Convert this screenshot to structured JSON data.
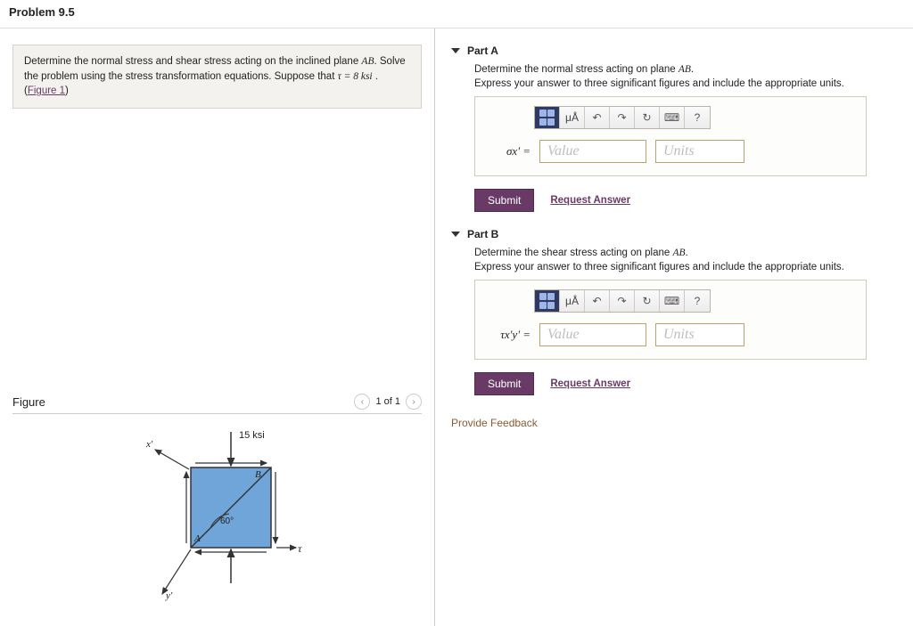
{
  "header": {
    "title": "Problem 9.5"
  },
  "problem": {
    "text_pre": "Determine the normal stress and shear stress acting on the inclined plane ",
    "ab": "AB",
    "text_mid": ". Solve the problem using the stress transformation equations. Suppose that ",
    "tau_eq": "τ = 8 ksi",
    "text_post": " . (",
    "figure_link": "Figure 1",
    "text_close": ")"
  },
  "figure": {
    "label": "Figure",
    "pager": "1 of 1",
    "stress_label": "15 ksi",
    "angle": "60°",
    "pt_a": "A",
    "pt_b": "B",
    "axis_x": "x'",
    "axis_y": "y'",
    "tau": "τ"
  },
  "parts": [
    {
      "title": "Part A",
      "prompt_pre": "Determine the normal stress acting on plane ",
      "prompt_ab": "AB",
      "prompt_post": ".",
      "directions": "Express your answer to three significant figures and include the appropriate units.",
      "symbol": "σx' =",
      "value_ph": "Value",
      "units_ph": "Units",
      "submit": "Submit",
      "request": "Request Answer",
      "mu": "μÅ",
      "help": "?"
    },
    {
      "title": "Part B",
      "prompt_pre": "Determine the shear stress acting on plane ",
      "prompt_ab": "AB",
      "prompt_post": ".",
      "directions": "Express your answer to three significant figures and include the appropriate units.",
      "symbol": "τx'y' =",
      "value_ph": "Value",
      "units_ph": "Units",
      "submit": "Submit",
      "request": "Request Answer",
      "mu": "μÅ",
      "help": "?"
    }
  ],
  "feedback": "Provide Feedback"
}
